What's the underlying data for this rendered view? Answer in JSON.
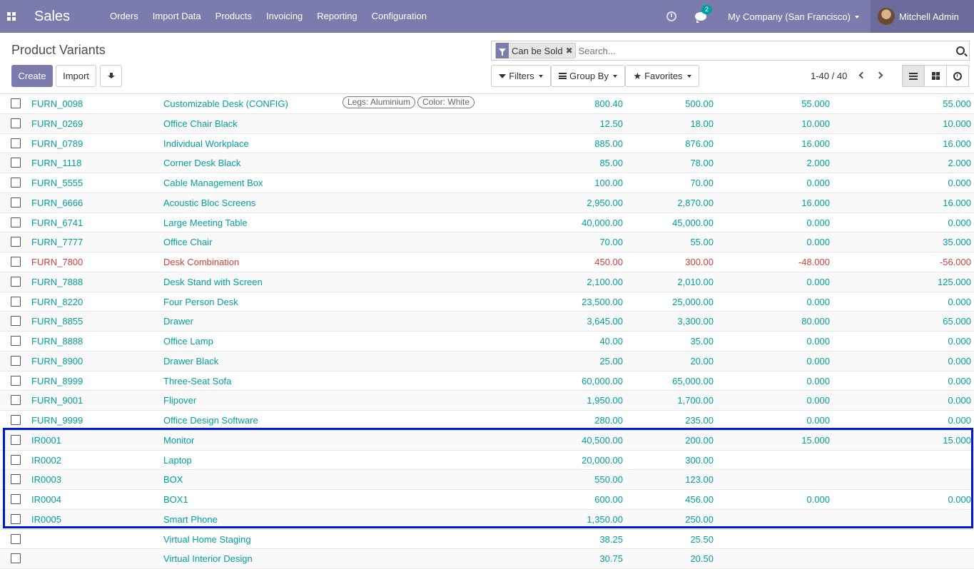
{
  "navbar": {
    "app_name": "Sales",
    "menu": [
      "Orders",
      "Import Data",
      "Products",
      "Invoicing",
      "Reporting",
      "Configuration"
    ],
    "chat_count": "2",
    "company": "My Company (San Francisco)",
    "user": "Mitchell Admin"
  },
  "control": {
    "title": "Product Variants",
    "create_label": "Create",
    "import_label": "Import",
    "facet_label": "Can be Sold",
    "search_placeholder": "Search...",
    "filters_label": "Filters",
    "groupby_label": "Group By",
    "favorites_label": "Favorites",
    "pager": "1-40 / 40"
  },
  "rows": [
    {
      "code": "FURN_0098",
      "name": "Customizable Desk (CONFIG)",
      "attrs": [
        "Legs: Aluminium",
        "Color: White"
      ],
      "price": "800.40",
      "cost": "500.00",
      "onhand": "55.000",
      "forecast": "55.000"
    },
    {
      "code": "FURN_0269",
      "name": "Office Chair Black",
      "attrs": [],
      "price": "12.50",
      "cost": "18.00",
      "onhand": "10.000",
      "forecast": "10.000"
    },
    {
      "code": "FURN_0789",
      "name": "Individual Workplace",
      "attrs": [],
      "price": "885.00",
      "cost": "876.00",
      "onhand": "16.000",
      "forecast": "16.000"
    },
    {
      "code": "FURN_1118",
      "name": "Corner Desk Black",
      "attrs": [],
      "price": "85.00",
      "cost": "78.00",
      "onhand": "2.000",
      "forecast": "2.000"
    },
    {
      "code": "FURN_5555",
      "name": "Cable Management Box",
      "attrs": [],
      "price": "100.00",
      "cost": "70.00",
      "onhand": "0.000",
      "forecast": "0.000"
    },
    {
      "code": "FURN_6666",
      "name": "Acoustic Bloc Screens",
      "attrs": [],
      "price": "2,950.00",
      "cost": "2,870.00",
      "onhand": "16.000",
      "forecast": "16.000"
    },
    {
      "code": "FURN_6741",
      "name": "Large Meeting Table",
      "attrs": [],
      "price": "40,000.00",
      "cost": "45,000.00",
      "onhand": "0.000",
      "forecast": "0.000"
    },
    {
      "code": "FURN_7777",
      "name": "Office Chair",
      "attrs": [],
      "price": "70.00",
      "cost": "55.00",
      "onhand": "0.000",
      "forecast": "35.000"
    },
    {
      "code": "FURN_7800",
      "name": "Desk Combination",
      "attrs": [],
      "price": "450.00",
      "cost": "300.00",
      "onhand": "-48.000",
      "forecast": "-56.000",
      "danger": true
    },
    {
      "code": "FURN_7888",
      "name": "Desk Stand with Screen",
      "attrs": [],
      "price": "2,100.00",
      "cost": "2,010.00",
      "onhand": "0.000",
      "forecast": "125.000"
    },
    {
      "code": "FURN_8220",
      "name": "Four Person Desk",
      "attrs": [],
      "price": "23,500.00",
      "cost": "25,000.00",
      "onhand": "0.000",
      "forecast": "0.000"
    },
    {
      "code": "FURN_8855",
      "name": "Drawer",
      "attrs": [],
      "price": "3,645.00",
      "cost": "3,300.00",
      "onhand": "80.000",
      "forecast": "65.000"
    },
    {
      "code": "FURN_8888",
      "name": "Office Lamp",
      "attrs": [],
      "price": "40.00",
      "cost": "35.00",
      "onhand": "0.000",
      "forecast": "0.000"
    },
    {
      "code": "FURN_8900",
      "name": "Drawer Black",
      "attrs": [],
      "price": "25.00",
      "cost": "20.00",
      "onhand": "0.000",
      "forecast": "0.000"
    },
    {
      "code": "FURN_8999",
      "name": "Three-Seat Sofa",
      "attrs": [],
      "price": "60,000.00",
      "cost": "65,000.00",
      "onhand": "0.000",
      "forecast": "0.000"
    },
    {
      "code": "FURN_9001",
      "name": "Flipover",
      "attrs": [],
      "price": "1,950.00",
      "cost": "1,700.00",
      "onhand": "0.000",
      "forecast": "0.000"
    },
    {
      "code": "FURN_9999",
      "name": "Office Design Software",
      "attrs": [],
      "price": "280.00",
      "cost": "235.00",
      "onhand": "0.000",
      "forecast": "0.000"
    },
    {
      "code": "IR0001",
      "name": "Monitor",
      "attrs": [],
      "price": "40,500.00",
      "cost": "200.00",
      "onhand": "15.000",
      "forecast": "15.000"
    },
    {
      "code": "IR0002",
      "name": "Laptop",
      "attrs": [],
      "price": "20,000.00",
      "cost": "300.00",
      "onhand": "",
      "forecast": ""
    },
    {
      "code": "IR0003",
      "name": "BOX",
      "attrs": [],
      "price": "550.00",
      "cost": "123.00",
      "onhand": "",
      "forecast": ""
    },
    {
      "code": "IR0004",
      "name": "BOX1",
      "attrs": [],
      "price": "600.00",
      "cost": "456.00",
      "onhand": "0.000",
      "forecast": "0.000"
    },
    {
      "code": "IR0005",
      "name": "Smart Phone",
      "attrs": [],
      "price": "1,350.00",
      "cost": "250.00",
      "onhand": "",
      "forecast": ""
    },
    {
      "code": "",
      "name": "Virtual Home Staging",
      "attrs": [],
      "price": "38.25",
      "cost": "25.50",
      "onhand": "",
      "forecast": ""
    },
    {
      "code": "",
      "name": "Virtual Interior Design",
      "attrs": [],
      "price": "30.75",
      "cost": "20.50",
      "onhand": "",
      "forecast": ""
    }
  ],
  "colors": {
    "brand": "#7c7bad",
    "link": "#00a09d",
    "danger": "#d23f3a",
    "highlight": "#0018d8"
  }
}
